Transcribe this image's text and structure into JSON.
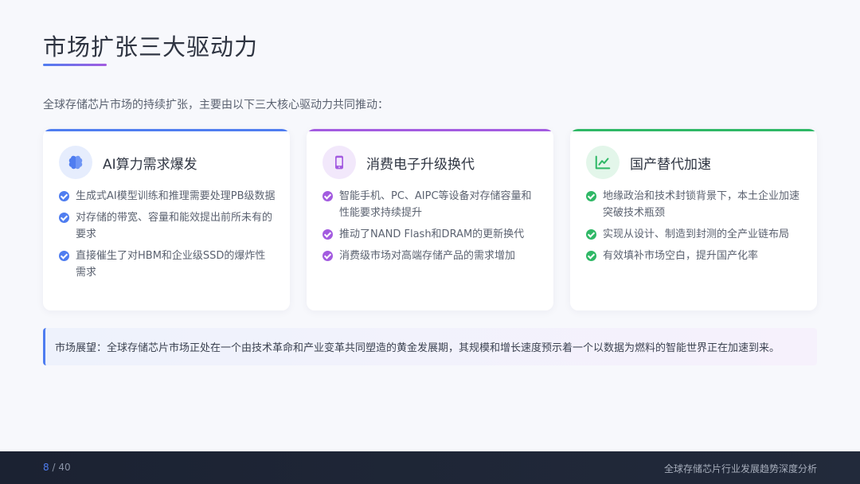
{
  "slide": {
    "title": "市场扩张三大驱动力",
    "intro": "全球存储芯片市场的持续扩张，主要由以下三大核心驱动力共同推动："
  },
  "cards": [
    {
      "title": "AI算力需求爆发",
      "icon": "brain-icon",
      "accent": "#4f7df0",
      "icon_bg": "#e6edfd",
      "items": [
        "生成式AI模型训练和推理需要处理PB级数据",
        "对存储的带宽、容量和能效提出前所未有的要求",
        "直接催生了对HBM和企业级SSD的爆炸性需求"
      ]
    },
    {
      "title": "消费电子升级换代",
      "icon": "smartphone-icon",
      "accent": "#a35be0",
      "icon_bg": "#f2e8fb",
      "items": [
        "智能手机、PC、AIPC等设备对存储容量和性能要求持续提升",
        "推动了NAND Flash和DRAM的更新换代",
        "消费级市场对高端存储产品的需求增加"
      ]
    },
    {
      "title": "国产替代加速",
      "icon": "trend-chart-icon",
      "accent": "#2fb866",
      "icon_bg": "#e3f6ea",
      "items": [
        "地缘政治和技术封锁背景下，本土企业加速突破技术瓶颈",
        "实现从设计、制造到封测的全产业链布局",
        "有效填补市场空白，提升国产化率"
      ]
    }
  ],
  "outlook": {
    "text": "市场展望：全球存储芯片市场正处在一个由技术革命和产业变革共同塑造的黄金发展期，其规模和增长速度预示着一个以数据为燃料的智能世界正在加速到来。"
  },
  "footer": {
    "current_page": "8",
    "total_pages": "40",
    "separator": " / ",
    "report_title": "全球存储芯片行业发展趋势深度分析"
  }
}
